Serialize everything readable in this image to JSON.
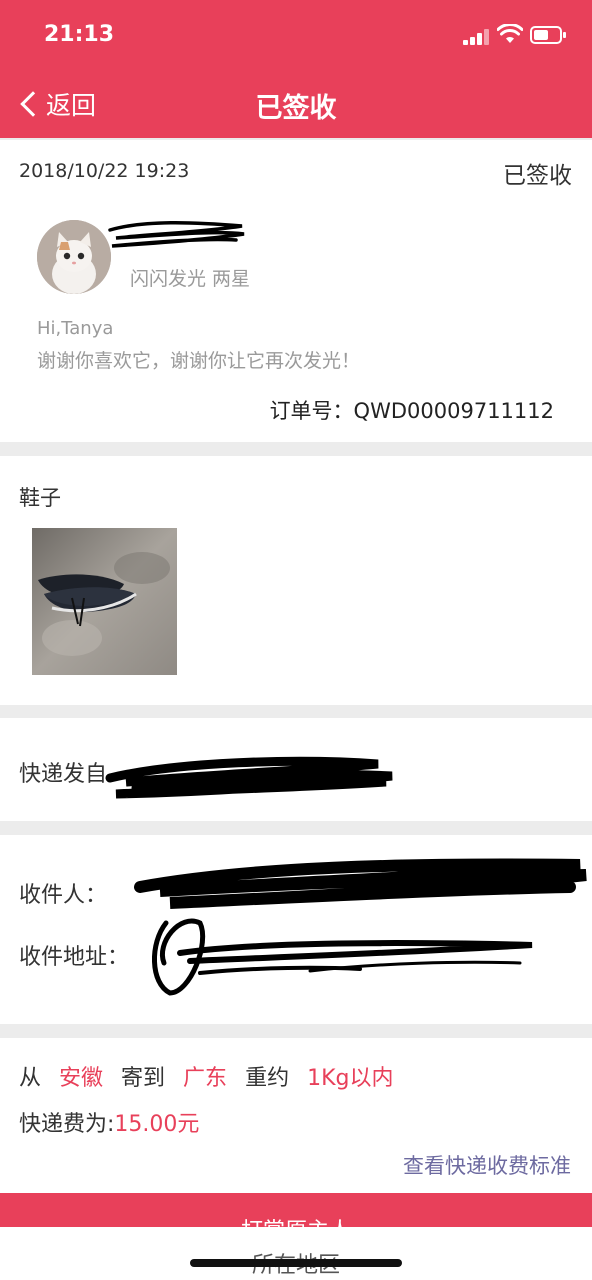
{
  "status_bar": {
    "time": "21:13"
  },
  "nav": {
    "back_label": "返回",
    "title": "已签收"
  },
  "order": {
    "date": "2018/10/22  19:23",
    "status": "已签收",
    "sender_subtitle": "闪闪发光 两星",
    "greeting": "Hi,Tanya",
    "message": "谢谢你喜欢它，谢谢你让它再次发光！",
    "order_no": "订单号：QWD00009711112"
  },
  "item": {
    "title": "鞋子"
  },
  "shipping": {
    "from_label": "快递发自"
  },
  "recipient": {
    "name_label": "收件人：",
    "address_label": "收件地址："
  },
  "fee": {
    "from_word": "从",
    "from_province": "安徽",
    "to_word": "寄到",
    "to_province": "广东",
    "weight_word": "重约",
    "weight_value": "1Kg以内",
    "fee_label": "快递费为:",
    "fee_value": "15.00元",
    "standard_link": "查看快递收费标准"
  },
  "bottom": {
    "button_text": "打赏原主人",
    "strip_text": "所在地区"
  },
  "colors": {
    "accent": "#e8405a",
    "link": "#6d6aa0"
  }
}
